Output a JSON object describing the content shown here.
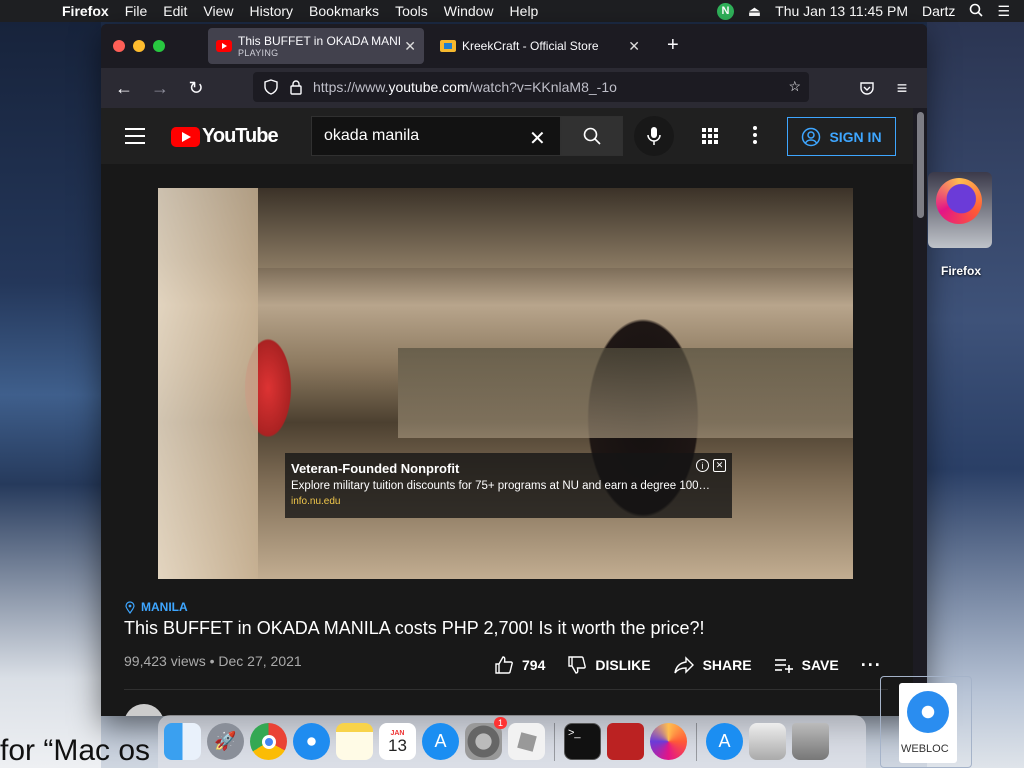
{
  "menubar": {
    "apple": "",
    "app": "Firefox",
    "items": [
      "File",
      "Edit",
      "View",
      "History",
      "Bookmarks",
      "Tools",
      "Window",
      "Help"
    ],
    "status_badge": "N",
    "clock": "Thu Jan 13  11:45 PM",
    "user": "Dartz"
  },
  "browser": {
    "tabs": [
      {
        "title": "This BUFFET in OKADA MANILA",
        "subtitle": "PLAYING",
        "active": true
      },
      {
        "title": "KreekCraft - Official Store",
        "subtitle": "",
        "active": false
      }
    ],
    "new_tab": "+",
    "url_prefix": "https://www.",
    "url_domain": "youtube.com",
    "url_path": "/watch?v=KKnlaM8_-1o"
  },
  "youtube": {
    "logo_text": "YouTube",
    "search_value": "okada manila",
    "sign_in": "SIGN IN",
    "ad": {
      "headline": "Veteran-Founded Nonprofit",
      "description": "Explore military tuition discounts for 75+ programs at NU and earn a degree 100…",
      "url": "info.nu.edu"
    },
    "location": "MANILA",
    "video_title": "This BUFFET in OKADA MANILA costs PHP 2,700! Is it worth the price?!",
    "meta": "99,423 views • Dec 27, 2021",
    "likes": "794",
    "dislike": "DISLIKE",
    "share": "SHARE",
    "save": "SAVE"
  },
  "desktop": {
    "firefox_label": "Firefox",
    "webloc_label": "WEBLOC",
    "bottom_text": "for “Mac os"
  },
  "dock": {
    "apps": [
      "finder",
      "launchpad",
      "chrome",
      "safari",
      "notes",
      "calendar",
      "app-store",
      "system-preferences",
      "roblox",
      "terminal",
      "photo-booth",
      "firefox",
      "app-store-downloads",
      "documents",
      "trash"
    ],
    "calendar_month": "JAN",
    "calendar_day": "13",
    "sysprefs_badge": "1"
  }
}
